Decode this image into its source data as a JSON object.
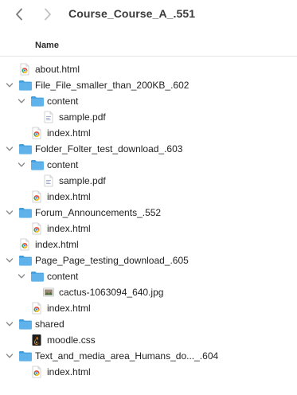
{
  "window": {
    "title": "Course_Course_A_.551"
  },
  "columns": {
    "name": "Name"
  },
  "rows": [
    {
      "label": "about.html",
      "kind": "html",
      "depth": 0,
      "chevron": "none"
    },
    {
      "label": "File_File_smaller_than_200KB_.602",
      "kind": "folder",
      "depth": 0,
      "chevron": "down"
    },
    {
      "label": "content",
      "kind": "folder",
      "depth": 1,
      "chevron": "down"
    },
    {
      "label": "sample.pdf",
      "kind": "pdf",
      "depth": 2,
      "chevron": "none"
    },
    {
      "label": "index.html",
      "kind": "html",
      "depth": 1,
      "chevron": "none"
    },
    {
      "label": "Folder_Folter_test_download_.603",
      "kind": "folder",
      "depth": 0,
      "chevron": "down"
    },
    {
      "label": "content",
      "kind": "folder",
      "depth": 1,
      "chevron": "down"
    },
    {
      "label": "sample.pdf",
      "kind": "pdf",
      "depth": 2,
      "chevron": "none"
    },
    {
      "label": "index.html",
      "kind": "html",
      "depth": 1,
      "chevron": "none"
    },
    {
      "label": "Forum_Announcements_.552",
      "kind": "folder",
      "depth": 0,
      "chevron": "down"
    },
    {
      "label": "index.html",
      "kind": "html",
      "depth": 1,
      "chevron": "none"
    },
    {
      "label": "index.html",
      "kind": "html",
      "depth": 0,
      "chevron": "none"
    },
    {
      "label": "Page_Page_testing_download_.605",
      "kind": "folder",
      "depth": 0,
      "chevron": "down"
    },
    {
      "label": "content",
      "kind": "folder",
      "depth": 1,
      "chevron": "down"
    },
    {
      "label": "cactus-1063094_640.jpg",
      "kind": "image",
      "depth": 2,
      "chevron": "none"
    },
    {
      "label": "index.html",
      "kind": "html",
      "depth": 1,
      "chevron": "none"
    },
    {
      "label": "shared",
      "kind": "folder",
      "depth": 0,
      "chevron": "down"
    },
    {
      "label": "moodle.css",
      "kind": "css",
      "depth": 1,
      "chevron": "none"
    },
    {
      "label": "Text_and_media_area_Humans_do..._.604",
      "kind": "folder",
      "depth": 0,
      "chevron": "down"
    },
    {
      "label": "index.html",
      "kind": "html",
      "depth": 1,
      "chevron": "none"
    }
  ],
  "colors": {
    "folder_body": "#5fb2ea",
    "folder_tab": "#3f9ddf",
    "chevron": "#8a8a8a",
    "nav_back": "#7a7a7a",
    "nav_forward": "#c2c2c2"
  },
  "icons": {
    "back": "chevron-left-icon",
    "forward": "chevron-right-icon",
    "folder": "folder-icon",
    "html": "html-file-icon",
    "pdf": "pdf-file-icon",
    "image": "image-file-icon",
    "css": "css-file-icon",
    "disclosure": "chevron-down-icon"
  }
}
